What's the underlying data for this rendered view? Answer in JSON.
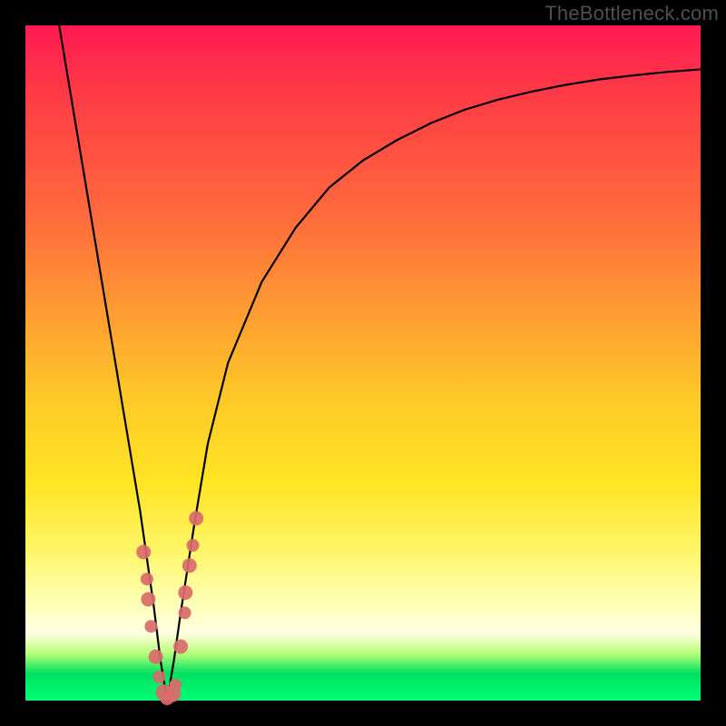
{
  "watermark": "TheBottleneck.com",
  "colors": {
    "frame": "#000000",
    "curve": "#000000",
    "marker_fill": "#d86b6b",
    "marker_stroke": "#b64f4f"
  },
  "chart_data": {
    "type": "line",
    "title": "",
    "xlabel": "",
    "ylabel": "",
    "xlim": [
      0,
      100
    ],
    "ylim": [
      0,
      100
    ],
    "notes": "V-shaped bottleneck curve. y-axis inverted visually (0 at bottom = green/good, 100 at top = red/bad). Minimum (optimal point) around x≈21, y≈0.",
    "series": [
      {
        "name": "bottleneck-curve",
        "x": [
          5,
          7,
          9,
          11,
          13,
          15,
          17,
          19,
          20,
          21,
          22,
          23,
          25,
          27,
          30,
          35,
          40,
          45,
          50,
          55,
          60,
          65,
          70,
          75,
          80,
          85,
          90,
          95,
          100
        ],
        "y": [
          100,
          88,
          76,
          64,
          52,
          40,
          28,
          14,
          6,
          0,
          6,
          13,
          26,
          38,
          50,
          62,
          70,
          76,
          80,
          83,
          85.5,
          87.5,
          89,
          90.2,
          91.2,
          92,
          92.6,
          93.1,
          93.5
        ]
      }
    ],
    "markers": {
      "name": "sample-points",
      "x": [
        17.5,
        18.0,
        18.2,
        18.6,
        19.3,
        19.8,
        20.5,
        21.0,
        21.8,
        22.2,
        23.0,
        23.6,
        23.7,
        24.3,
        24.8,
        25.3
      ],
      "y": [
        22,
        18,
        15,
        11,
        6.5,
        3.5,
        1.2,
        0.4,
        1.0,
        2.3,
        8,
        13,
        16,
        20,
        23,
        27
      ],
      "r": [
        8,
        7,
        8,
        7,
        8,
        7,
        9,
        8,
        9,
        7,
        8,
        7,
        8,
        8,
        7,
        8
      ]
    }
  }
}
